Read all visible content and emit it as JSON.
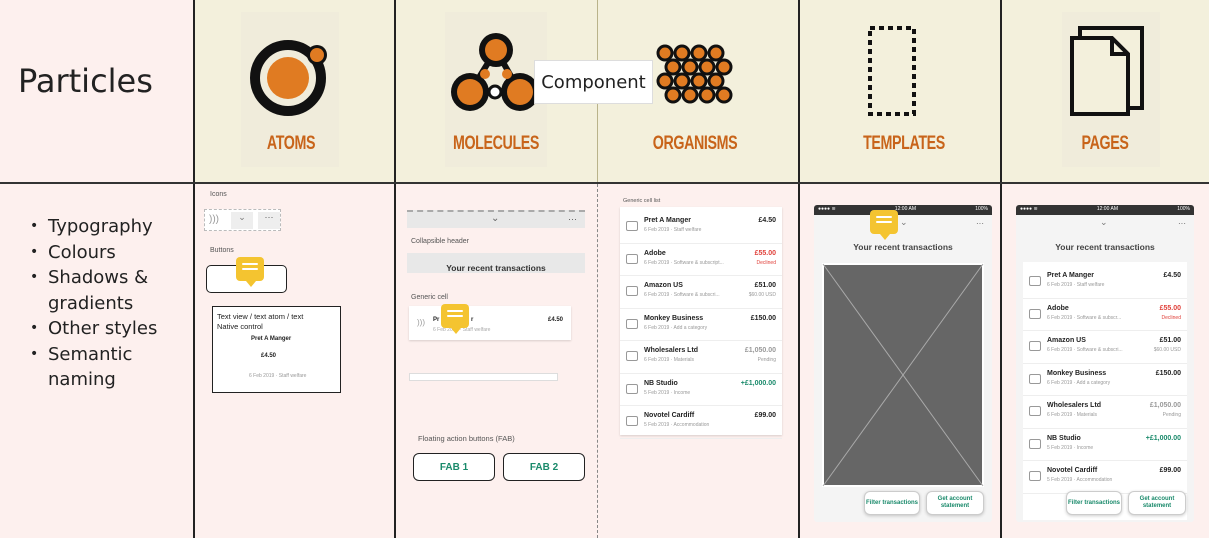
{
  "left": {
    "title": "Particles",
    "items": [
      "Typography",
      "Colours",
      "Shadows & gradients",
      "Other styles",
      "Semantic naming"
    ]
  },
  "categories": {
    "atoms": "ATOMS",
    "molecules": "MOLECULES",
    "organisms": "ORGANISMS",
    "templates": "TEMPLATES",
    "pages": "PAGES"
  },
  "component_label": "Component",
  "atoms_panel": {
    "icons_label": "Icons",
    "buttons_label": "Buttons",
    "text_view_label": "Text view / text atom / text",
    "native_control_label": "Native control",
    "name": "Pret A Manger",
    "amount": "£4.50",
    "date": "6 Feb 2019 · Staff welfare"
  },
  "molecules_panel": {
    "collapsible_header_label": "Collapsible header",
    "header_title": "Your recent transactions",
    "generic_cell_label": "Generic cell",
    "cell_name": "Pr",
    "cell_name_end": "r",
    "cell_amount": "£4.50",
    "cell_sub": "6 Feb 2019 · Staff welfare",
    "fab_label": "Floating action buttons (FAB)",
    "fab1": "FAB 1",
    "fab2": "FAB 2"
  },
  "organisms_panel": {
    "label": "Generic cell list",
    "rows": [
      {
        "name": "Pret A Manger",
        "sub": "6 Feb 2019 · Staff welfare",
        "amount": "£4.50",
        "amount2": "",
        "color": "#222222"
      },
      {
        "name": "Adobe",
        "sub": "6 Feb 2019 · Software & subscript...",
        "amount": "£55.00",
        "amount2": "Declined",
        "color": "#e0403a"
      },
      {
        "name": "Amazon US",
        "sub": "6 Feb 2019 · Software & subscri...",
        "amount": "£51.00",
        "amount2": "$60.00 USD",
        "color": "#222222"
      },
      {
        "name": "Monkey Business",
        "sub": "6 Feb 2019 · Add a category",
        "amount": "£150.00",
        "amount2": "",
        "color": "#222222"
      },
      {
        "name": "Wholesalers Ltd",
        "sub": "6 Feb 2019 · Materials",
        "amount": "£1,050.00",
        "amount2": "Pending",
        "color": "#999999"
      },
      {
        "name": "NB Studio",
        "sub": "5 Feb 2019 · Income",
        "amount": "+£1,000.00",
        "amount2": "",
        "color": "#1a8a6b"
      },
      {
        "name": "Novotel Cardiff",
        "sub": "5 Feb 2019 · Accommodation",
        "amount": "£99.00",
        "amount2": "",
        "color": "#222222"
      }
    ]
  },
  "templates_panel": {
    "time": "12:00 AM",
    "battery": "100%",
    "title": "Your recent transactions",
    "filter_btn": "Filter transactions",
    "statement_btn": "Get account statement"
  },
  "pages_panel": {
    "time": "12:00 AM",
    "battery": "100%",
    "title": "Your recent transactions",
    "rows": [
      {
        "name": "Pret A Manger",
        "sub": "6 Feb 2019 · Staff welfare",
        "amount": "£4.50",
        "amount2": "",
        "color": "#222222"
      },
      {
        "name": "Adobe",
        "sub": "6 Feb 2019 · Software & subscr...",
        "amount": "£55.00",
        "amount2": "Declined",
        "color": "#e0403a"
      },
      {
        "name": "Amazon US",
        "sub": "6 Feb 2019 · Software & subscri...",
        "amount": "£51.00",
        "amount2": "$60.00 USD",
        "color": "#222222"
      },
      {
        "name": "Monkey Business",
        "sub": "6 Feb 2019 · Add a category",
        "amount": "£150.00",
        "amount2": "",
        "color": "#222222"
      },
      {
        "name": "Wholesalers Ltd",
        "sub": "6 Feb 2019 · Materials",
        "amount": "£1,050.00",
        "amount2": "Pending",
        "color": "#999999"
      },
      {
        "name": "NB Studio",
        "sub": "5 Feb 2019 · Income",
        "amount": "+£1,000.00",
        "amount2": "",
        "color": "#1a8a6b"
      },
      {
        "name": "Novotel Cardiff",
        "sub": "5 Feb 2019 · Accommodation",
        "amount": "£99.00",
        "amount2": "",
        "color": "#222222"
      }
    ],
    "filter_btn": "Filter transactions",
    "statement_btn": "Get account statement"
  },
  "colors": {
    "accent": "#c8641a",
    "atom_orange": "#e07b22",
    "teal": "#1a8a6b",
    "header_bg": "#f3f0dc",
    "page_bg": "#fdf0ee"
  }
}
